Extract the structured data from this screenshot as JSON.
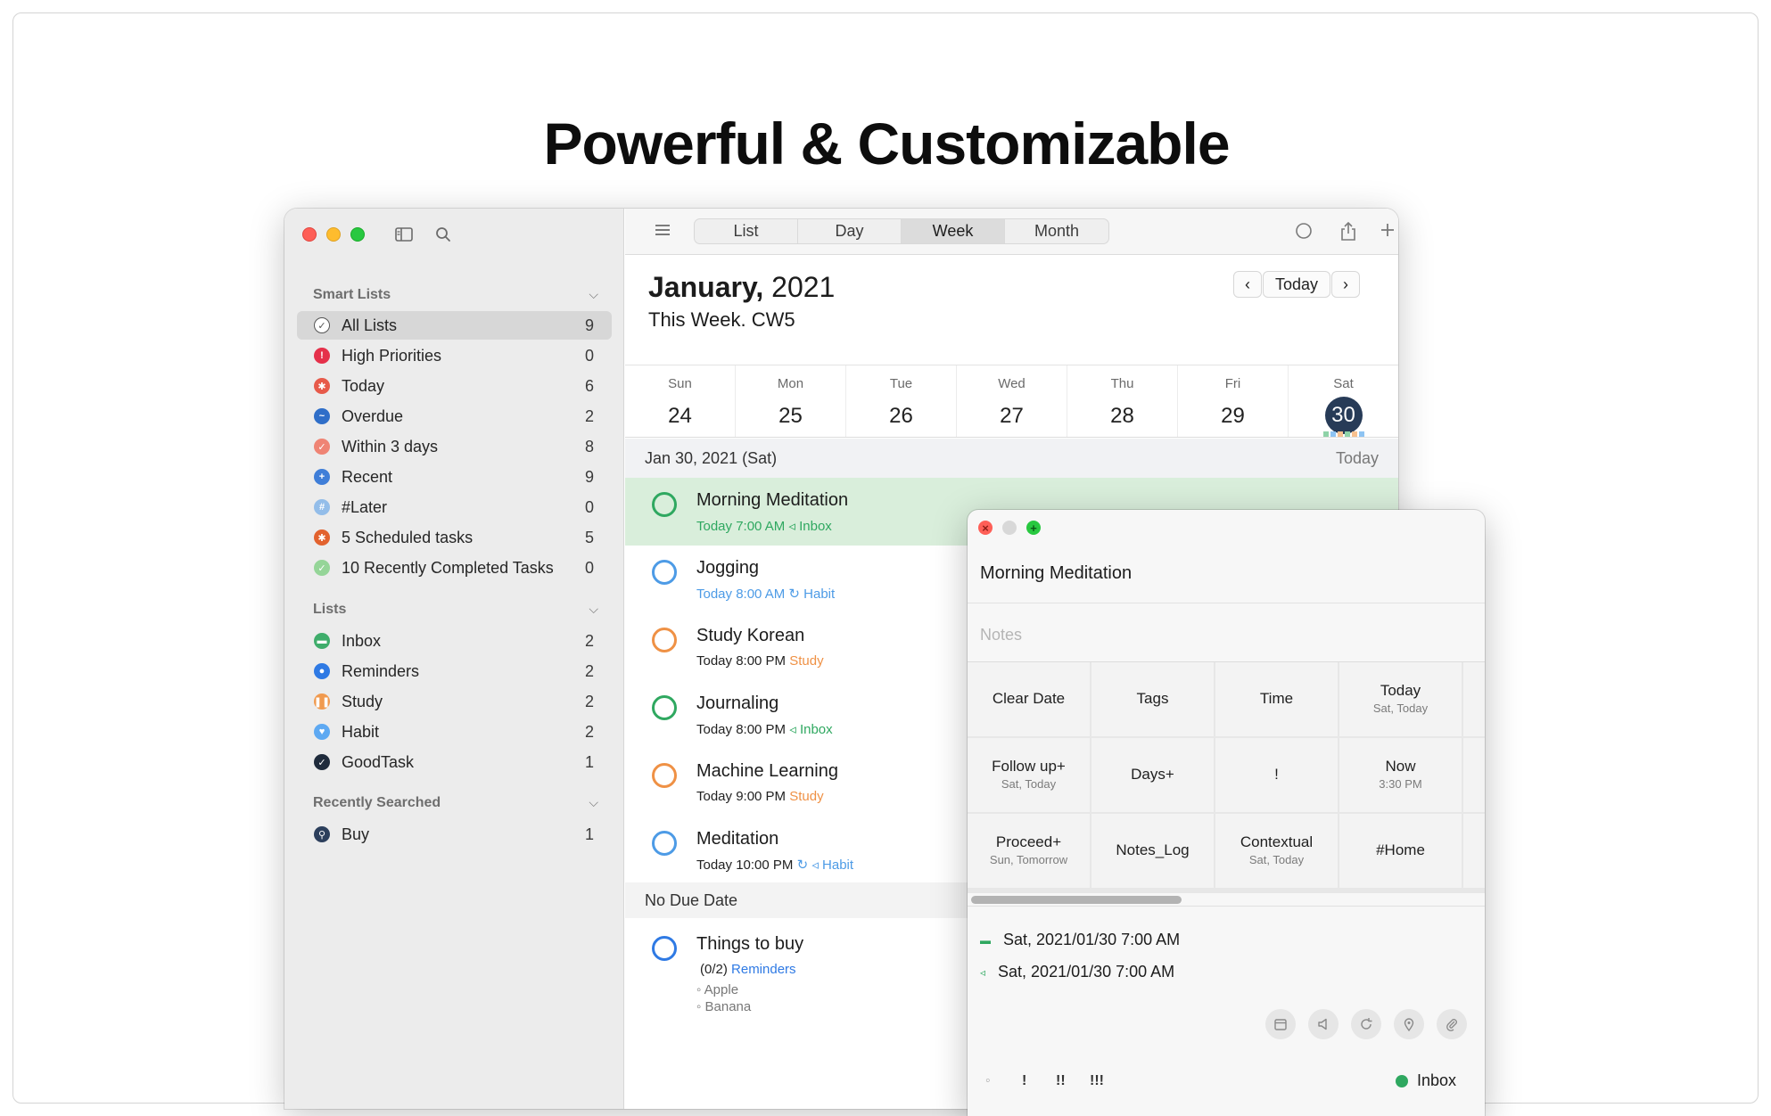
{
  "headline": "Powerful & Customizable",
  "sidebar": {
    "smart_lists_header": "Smart Lists",
    "smart_lists": [
      {
        "label": "All Lists",
        "count": "9",
        "color": "#ffffff"
      },
      {
        "label": "High Priorities",
        "count": "0",
        "color": "#e5304a"
      },
      {
        "label": "Today",
        "count": "6",
        "color": "#e75a4a"
      },
      {
        "label": "Overdue",
        "count": "2",
        "color": "#2f6ec8"
      },
      {
        "label": "Within 3 days",
        "count": "8",
        "color": "#ef8474"
      },
      {
        "label": "Recent",
        "count": "9",
        "color": "#3f7ed8"
      },
      {
        "label": "#Later",
        "count": "0",
        "color": "#93bde9"
      },
      {
        "label": "5 Scheduled tasks",
        "count": "5",
        "color": "#e2622e"
      },
      {
        "label": "10 Recently Completed Tasks",
        "count": "0",
        "color": "#95d598"
      }
    ],
    "lists_header": "Lists",
    "lists": [
      {
        "label": "Inbox",
        "count": "2",
        "color": "#3fad6b"
      },
      {
        "label": "Reminders",
        "count": "2",
        "color": "#2f7ae4"
      },
      {
        "label": "Study",
        "count": "2",
        "color": "#f09a4f"
      },
      {
        "label": "Habit",
        "count": "2",
        "color": "#5ea9f2"
      },
      {
        "label": "GoodTask",
        "count": "1",
        "color": "#1f2b3c"
      }
    ],
    "recent_header": "Recently Searched",
    "recent": [
      {
        "label": "Buy",
        "count": "1",
        "color": "#2c3f5c"
      }
    ]
  },
  "toolbar": {
    "tabs": [
      "List",
      "Day",
      "Week",
      "Month"
    ],
    "active_tab": "Week"
  },
  "calendar": {
    "month": "January,",
    "year": " 2021",
    "week_label": "This Week. CW5",
    "today_button": "Today",
    "days": [
      {
        "name": "Sun",
        "num": "24"
      },
      {
        "name": "Mon",
        "num": "25"
      },
      {
        "name": "Tue",
        "num": "26"
      },
      {
        "name": "Wed",
        "num": "27"
      },
      {
        "name": "Thu",
        "num": "28"
      },
      {
        "name": "Fri",
        "num": "29"
      },
      {
        "name": "Sat",
        "num": "30"
      }
    ],
    "date_header": "Jan 30, 2021 (Sat)",
    "date_header_right": "Today"
  },
  "tasks": [
    {
      "title": "Morning Meditation",
      "time": "Today 7:00 AM",
      "list": "Inbox",
      "icon": "speaker-icon",
      "color": "#2fa860",
      "time_color": "#2fa860"
    },
    {
      "title": "Jogging",
      "time": "Today 8:00 AM",
      "list": "Habit",
      "icon": "repeat-icon",
      "color": "#4d9be6",
      "time_color": "#4d9be6"
    },
    {
      "title": "Study Korean",
      "time": "Today 8:00 PM",
      "list": "Study",
      "icon": "",
      "color": "#ef9145",
      "time_color": "#222222"
    },
    {
      "title": "Journaling",
      "time": "Today 8:00 PM",
      "list": "Inbox",
      "icon": "speaker-icon",
      "color": "#2fa860",
      "time_color": "#222222"
    },
    {
      "title": "Machine Learning",
      "time": "Today 9:00 PM",
      "list": "Study",
      "icon": "",
      "color": "#ef9145",
      "time_color": "#222222"
    },
    {
      "title": "Meditation",
      "time": "Today 10:00 PM",
      "list": "Habit",
      "icon": "repeat-speaker-icon",
      "color": "#4d9be6",
      "time_color": "#222222"
    }
  ],
  "no_due_header": "No Due Date",
  "no_due_task": {
    "title": "Things to buy",
    "progress": "(0/2)",
    "list": "Reminders",
    "subitems": [
      "Apple",
      "Banana"
    ]
  },
  "detail": {
    "title": "Morning Meditation",
    "notes_placeholder": "Notes",
    "actions": [
      {
        "main": "Clear Date",
        "sub": ""
      },
      {
        "main": "Tags",
        "sub": ""
      },
      {
        "main": "Time",
        "sub": ""
      },
      {
        "main": "Today",
        "sub": "Sat, Today"
      },
      {
        "main": "Follow up+",
        "sub": "Sat, Today"
      },
      {
        "main": "Days+",
        "sub": ""
      },
      {
        "main": "!",
        "sub": ""
      },
      {
        "main": "Now",
        "sub": "3:30 PM"
      },
      {
        "main": "Proceed+",
        "sub": "Sun, Tomorrow"
      },
      {
        "main": "Notes_Log",
        "sub": ""
      },
      {
        "main": "Contextual",
        "sub": "Sat, Today"
      },
      {
        "main": "#Home",
        "sub": ""
      }
    ],
    "due_date": "Sat, 2021/01/30 7:00 AM",
    "alarm": "Sat, 2021/01/30 7:00 AM",
    "priorities": [
      "◦",
      "!",
      "!!",
      "!!!"
    ],
    "list_name": "Inbox",
    "list_color": "#2fa860"
  }
}
